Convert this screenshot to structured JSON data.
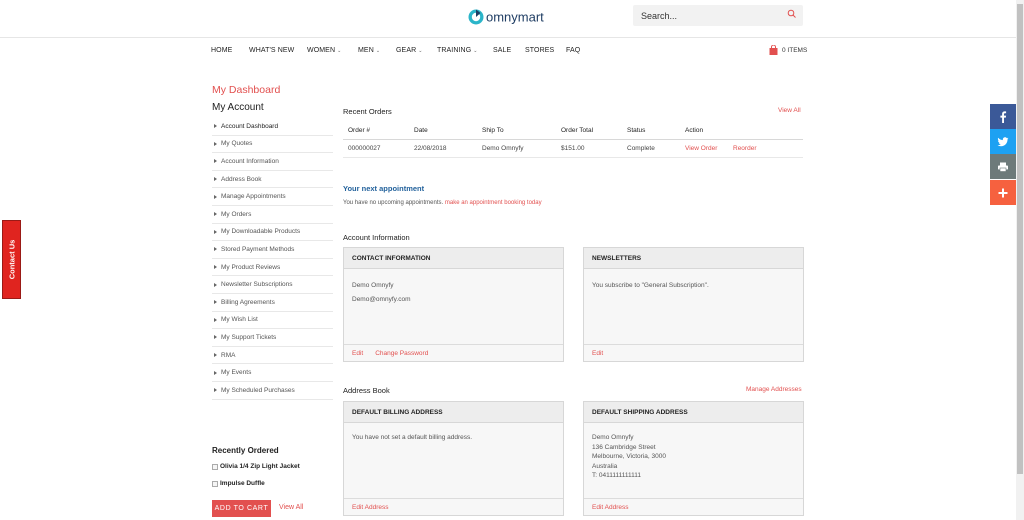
{
  "header": {
    "logo_text": "omnymart",
    "search_placeholder": "Search..."
  },
  "nav": {
    "items": [
      {
        "label": "HOME",
        "dropdown": false
      },
      {
        "label": "WHAT'S NEW",
        "dropdown": false
      },
      {
        "label": "WOMEN",
        "dropdown": true
      },
      {
        "label": "MEN",
        "dropdown": true
      },
      {
        "label": "GEAR",
        "dropdown": true
      },
      {
        "label": "TRAINING",
        "dropdown": true
      },
      {
        "label": "SALE",
        "dropdown": false
      },
      {
        "label": "STORES",
        "dropdown": false
      },
      {
        "label": "FAQ",
        "dropdown": false
      }
    ],
    "cart_label": "0 ITEMS"
  },
  "page": {
    "dashboard_title": "My Dashboard",
    "account_title": "My Account"
  },
  "sidebar": {
    "items": [
      {
        "label": "Account Dashboard",
        "active": true
      },
      {
        "label": "My Quotes"
      },
      {
        "label": "Account Information"
      },
      {
        "label": "Address Book"
      },
      {
        "label": "Manage Appointments"
      },
      {
        "label": "My Orders"
      },
      {
        "label": "My Downloadable Products"
      },
      {
        "label": "Stored Payment Methods"
      },
      {
        "label": "My Product Reviews"
      },
      {
        "label": "Newsletter Subscriptions"
      },
      {
        "label": "Billing Agreements"
      },
      {
        "label": "My Wish List"
      },
      {
        "label": "My Support Tickets"
      },
      {
        "label": "RMA"
      },
      {
        "label": "My Events"
      },
      {
        "label": "My Scheduled Purchases"
      }
    ]
  },
  "recently_ordered": {
    "title": "Recently Ordered",
    "items": [
      "Olivia 1/4 Zip Light Jacket",
      "Impulse Duffle"
    ],
    "add_to_cart_label": "ADD TO CART",
    "view_all_label": "View All"
  },
  "contact_tab": "Contact Us",
  "recent_orders": {
    "title": "Recent Orders",
    "view_all_label": "View All",
    "columns": [
      "Order #",
      "Date",
      "Ship To",
      "Order Total",
      "Status",
      "Action"
    ],
    "rows": [
      {
        "order": "000000027",
        "date": "22/08/2018",
        "ship_to": "Demo Omnyfy",
        "total": "$151.00",
        "status": "Complete",
        "view_label": "View Order",
        "reorder_label": "Reorder"
      }
    ]
  },
  "appointment": {
    "title": "Your next appointment",
    "text": "You have no upcoming appointments.",
    "link": "make an appointment booking today"
  },
  "account_info": {
    "title": "Account Information",
    "contact": {
      "head": "CONTACT INFORMATION",
      "name": "Demo Omnyfy",
      "email": "Demo@omnyfy.com",
      "edit_label": "Edit",
      "change_password_label": "Change Password"
    },
    "newsletters": {
      "head": "NEWSLETTERS",
      "text": "You subscribe to \"General Subscription\".",
      "edit_label": "Edit"
    }
  },
  "address_book": {
    "title": "Address Book",
    "manage_label": "Manage Addresses",
    "billing": {
      "head": "DEFAULT BILLING ADDRESS",
      "text": "You have not set a default billing address.",
      "edit_label": "Edit Address"
    },
    "shipping": {
      "head": "DEFAULT SHIPPING ADDRESS",
      "lines": [
        "Demo Omnyfy",
        "136 Cambridge Street",
        "Melbourne, Victoria, 3000",
        "Australia",
        "T: 0411111111111"
      ],
      "edit_label": "Edit Address"
    }
  },
  "share_bar": [
    {
      "icon": "facebook-icon",
      "color": "#3b5998"
    },
    {
      "icon": "twitter-icon",
      "color": "#1da1f2"
    },
    {
      "icon": "print-icon",
      "color": "#6d7a7a"
    },
    {
      "icon": "plus-icon",
      "color": "#f6613f"
    }
  ],
  "colors": {
    "accent": "#e2504f",
    "appointment_blue": "#23629c",
    "contact_tab_red": "#e0241f"
  }
}
